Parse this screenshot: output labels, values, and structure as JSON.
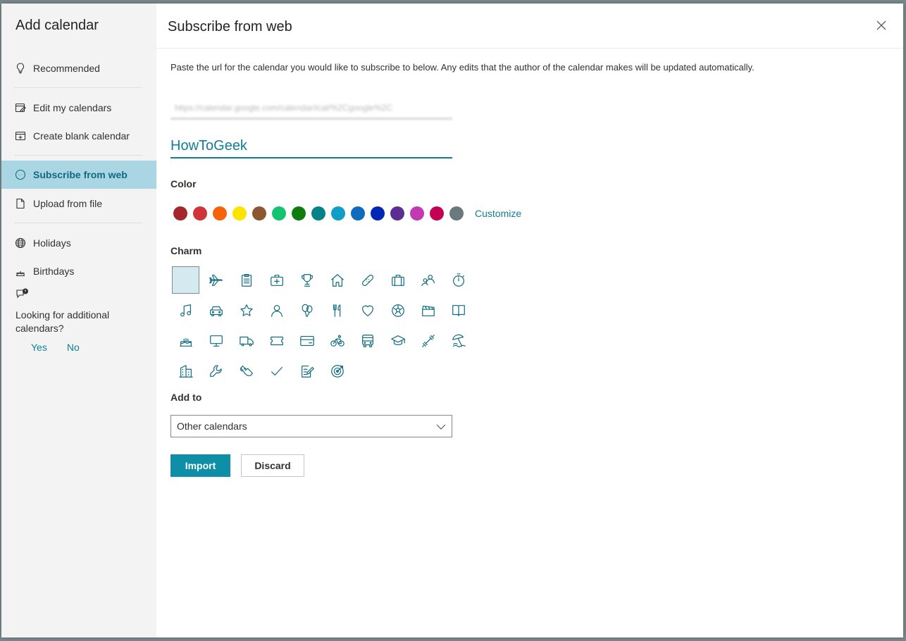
{
  "left": {
    "title": "Add calendar",
    "items": [
      {
        "label": "Recommended",
        "icon": "lightbulb-icon"
      },
      {
        "label": "Edit my calendars",
        "icon": "edit-calendar-icon"
      },
      {
        "label": "Create blank calendar",
        "icon": "add-calendar-icon"
      },
      {
        "label": "Subscribe from web",
        "icon": "web-subscribe-icon",
        "active": true
      },
      {
        "label": "Upload from file",
        "icon": "file-icon"
      },
      {
        "label": "Holidays",
        "icon": "globe-icon"
      },
      {
        "label": "Birthdays",
        "icon": "cake-icon"
      }
    ],
    "looking": {
      "text": "Looking for additional calendars?",
      "yes": "Yes",
      "no": "No"
    }
  },
  "main": {
    "title": "Subscribe from web",
    "description": "Paste the url for the calendar you would like to subscribe to below. Any edits that the author of the calendar makes will be updated automatically.",
    "url_value": "https://calendar.google.com/calendar/ical/%2Cgoogle%2C",
    "name_value": "HowToGeek",
    "color_label": "Color",
    "colors": [
      "#a4262c",
      "#d13438",
      "#f7630c",
      "#fde300",
      "#8e562e",
      "#13c46f",
      "#107c10",
      "#038387",
      "#0f9ec8",
      "#0f6cbd",
      "#0027b4",
      "#5c2e91",
      "#c239b3",
      "#c30052",
      "#69797e"
    ],
    "customize": "Customize",
    "charm_label": "Charm",
    "add_to_label": "Add to",
    "add_to_value": "Other calendars",
    "import_label": "Import",
    "discard_label": "Discard"
  }
}
